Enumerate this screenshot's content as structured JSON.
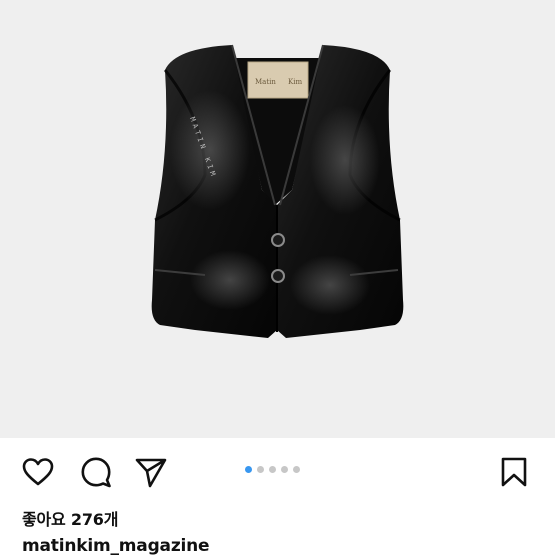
{
  "post": {
    "image": {
      "label_left": "Matin",
      "label_right": "Kim",
      "embroidery": "MATIN KIM"
    },
    "carousel": {
      "count": 5,
      "active_index": 0
    },
    "likes_text": "좋아요 276개",
    "username": "matinkim_magazine"
  },
  "icons": {
    "like": "heart-icon",
    "comment": "comment-icon",
    "share": "send-icon",
    "save": "bookmark-icon"
  },
  "colors": {
    "accent": "#3897f0",
    "dot_inactive": "#c7c7c7",
    "photo_background": "#efefef"
  }
}
